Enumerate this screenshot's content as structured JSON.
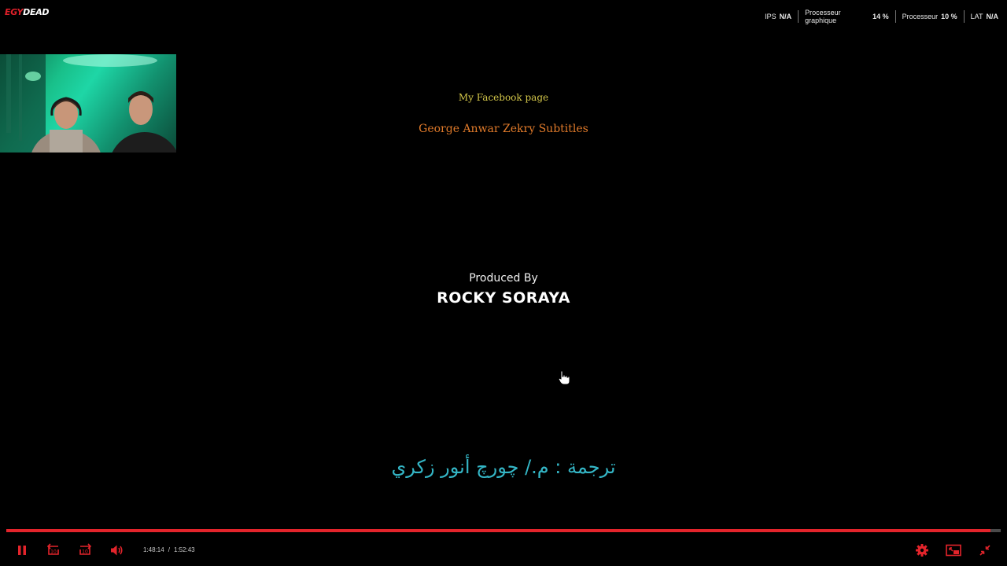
{
  "brand": {
    "logo_prefix": "EGY",
    "logo_suffix": "DEAD"
  },
  "perf_overlay": {
    "ips_label": "IPS",
    "ips_value": "N/A",
    "gpu_label": "Processeur graphique",
    "gpu_value": "14 %",
    "cpu_label": "Processeur",
    "cpu_value": "10 %",
    "lat_label": "LAT",
    "lat_value": "N/A"
  },
  "video": {
    "credit_facebook": "My Facebook page",
    "credit_subtitles": "George Anwar Zekry Subtitles",
    "produced_by": "Produced By",
    "producer_name": "ROCKY SORAYA",
    "subtitle": "ترجمة : م./ چورچ أنور زكري"
  },
  "player": {
    "current_time": "1:48:14",
    "time_separator": "/",
    "duration": "1:52:43",
    "progress": 0.99,
    "rewind_label": "10",
    "forward_label": "10"
  },
  "colors": {
    "accent": "#e3242b",
    "subtitle": "#34b6c6",
    "credit_facebook": "#d4c74a",
    "credit_subtitles": "#e07a2a"
  },
  "icons": {
    "play_pause": "pause-icon",
    "rewind": "rewind-10-icon",
    "forward": "forward-10-icon",
    "volume": "volume-icon",
    "settings": "gear-icon",
    "pip": "picture-in-picture-icon",
    "fullscreen": "exit-fullscreen-icon"
  }
}
